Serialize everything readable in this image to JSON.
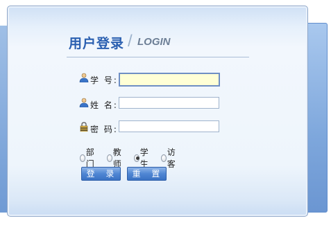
{
  "header": {
    "title": "用户登录",
    "subtitle": "LOGIN"
  },
  "form": {
    "fields": [
      {
        "label": "学 号:",
        "value": "",
        "icon": "user-icon"
      },
      {
        "label": "姓 名:",
        "value": "",
        "icon": "user-icon"
      },
      {
        "label": "密 码:",
        "value": "",
        "icon": "lock-icon"
      }
    ],
    "roles": [
      {
        "label": "部门",
        "checked": false
      },
      {
        "label": "教师",
        "checked": false
      },
      {
        "label": "学生",
        "checked": true
      },
      {
        "label": "访客",
        "checked": false
      }
    ],
    "login_label": "登 录",
    "reset_label": "重 置"
  },
  "colors": {
    "title": "#2a5fb0",
    "button": "#3a72c4",
    "focused_field": "#ffffd6"
  }
}
